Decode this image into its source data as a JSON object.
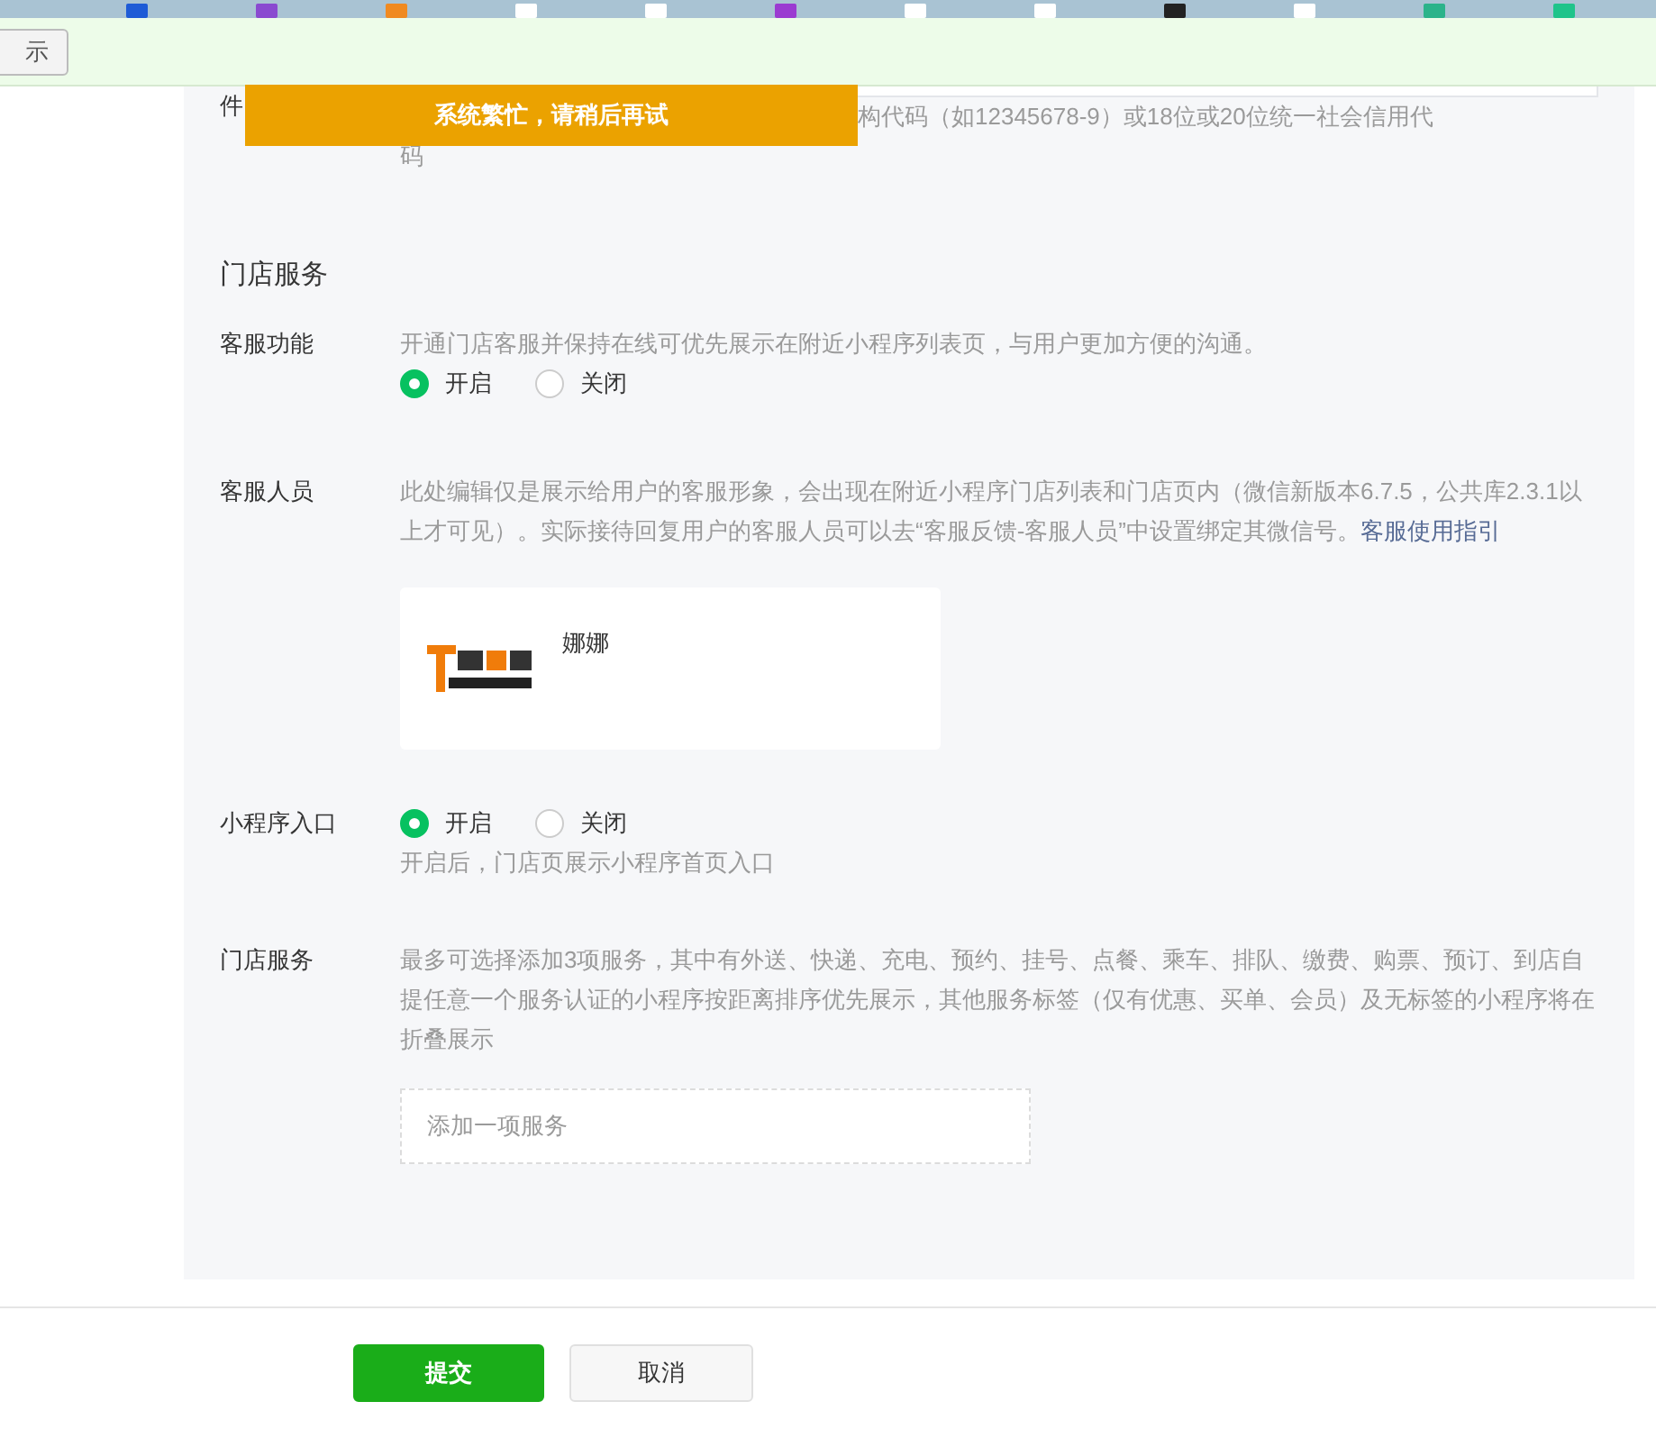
{
  "notice_bar": {
    "button": "示"
  },
  "toast": "系统繁忙，请稍后再试",
  "partial_row": {
    "label": "件",
    "hint_parts": [
      "构代码（如12345678-9）或18位或20位统一社会信用代",
      "码"
    ]
  },
  "section_title": "门店服务",
  "rows": [
    {
      "kind": "radio",
      "label": "客服功能",
      "description": "开通门店客服并保持在线可优先展示在附近小程序列表页，与用户更加方便的沟通。",
      "options": [
        {
          "label": "开启",
          "selected": true
        },
        {
          "label": "关闭",
          "selected": false
        }
      ]
    },
    {
      "kind": "staff",
      "label": "客服人员",
      "description": "此处编辑仅是展示给用户的客服形象，会出现在附近小程序门店列表和门店页内（微信新版本6.7.5，公共库2.3.1以上才可见）。实际接待回复用户的客服人员可以去“客服反馈-客服人员”中设置绑定其微信号。",
      "link": "客服使用指引",
      "staff": {
        "name": "娜娜"
      }
    },
    {
      "kind": "radio",
      "label": "小程序入口",
      "options": [
        {
          "label": "开启",
          "selected": true
        },
        {
          "label": "关闭",
          "selected": false
        }
      ],
      "hint": "开启后，门店页展示小程序首页入口"
    },
    {
      "kind": "service",
      "label": "门店服务",
      "description": "最多可选择添加3项服务，其中有外送、快递、充电、预约、挂号、点餐、乘车、排队、缴费、购票、预订、到店自提任意一个服务认证的小程序按距离排序优先展示，其他服务标签（仅有优惠、买单、会员）及无标签的小程序将在折叠展示",
      "placeholder": "添加一项服务"
    }
  ],
  "buttons": [
    {
      "label": "提交",
      "kind": "primary"
    },
    {
      "label": "取消",
      "kind": "default"
    }
  ]
}
